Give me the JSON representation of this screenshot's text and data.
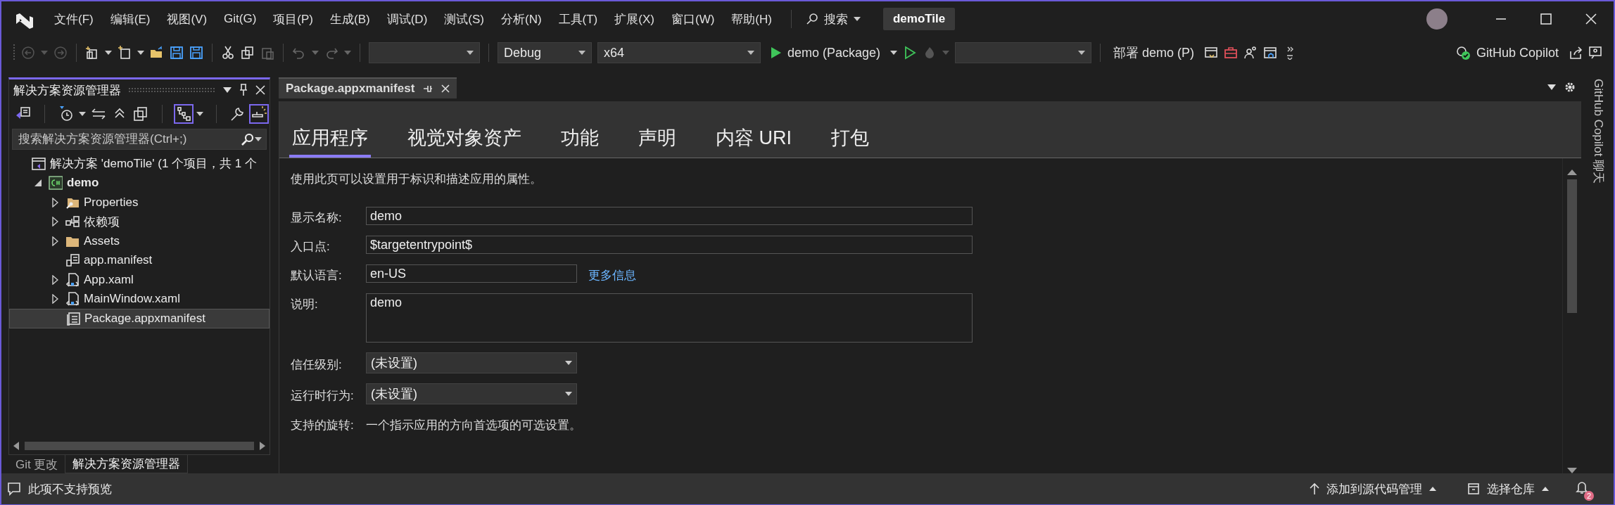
{
  "menu": [
    "文件(F)",
    "编辑(E)",
    "视图(V)",
    "Git(G)",
    "项目(P)",
    "生成(B)",
    "调试(D)",
    "测试(S)",
    "分析(N)",
    "工具(T)",
    "扩展(X)",
    "窗口(W)",
    "帮助(H)"
  ],
  "search": {
    "label": "搜索"
  },
  "project_title": "demoTile",
  "toolbar": {
    "configuration": "Debug",
    "platform": "x64",
    "run_target": "demo (Package)",
    "deploy": "部署 demo (P)",
    "copilot": "GitHub Copilot"
  },
  "solution_explorer": {
    "title": "解决方案资源管理器",
    "search": {
      "placeholder": "搜索解决方案资源管理器(Ctrl+;)"
    },
    "tree": [
      {
        "label": "解决方案 'demoTile' (1 个项目，共 1 个",
        "kind": "solution",
        "selected": false,
        "children": [
          {
            "label": "demo",
            "kind": "csharp-project",
            "expanded": true,
            "bold": true,
            "selected": false,
            "children": [
              {
                "label": "Properties",
                "kind": "properties-folder",
                "expanded": false,
                "selected": false
              },
              {
                "label": "依赖项",
                "kind": "dependencies",
                "expanded": false,
                "selected": false
              },
              {
                "label": "Assets",
                "kind": "folder",
                "expanded": false,
                "selected": false
              },
              {
                "label": "app.manifest",
                "kind": "manifest",
                "selected": false
              },
              {
                "label": "App.xaml",
                "kind": "xaml",
                "expanded": false,
                "selected": false
              },
              {
                "label": "MainWindow.xaml",
                "kind": "xaml",
                "expanded": false,
                "selected": false
              },
              {
                "label": "Package.appxmanifest",
                "kind": "appxmanifest",
                "selected": true
              }
            ]
          }
        ]
      }
    ],
    "bottom_tabs": [
      {
        "label": "Git 更改",
        "selected": false
      },
      {
        "label": "解决方案资源管理器",
        "selected": true
      }
    ]
  },
  "document_tab": {
    "title": "Package.appxmanifest"
  },
  "page_tabs": [
    {
      "label": "应用程序",
      "selected": true
    },
    {
      "label": "视觉对象资产",
      "selected": false
    },
    {
      "label": "功能",
      "selected": false
    },
    {
      "label": "声明",
      "selected": false
    },
    {
      "label": "内容 URI",
      "selected": false
    },
    {
      "label": "打包",
      "selected": false
    }
  ],
  "intro": "使用此页可以设置用于标识和描述应用的属性。",
  "fields": [
    {
      "kind": "text",
      "label": "显示名称:",
      "value": "demo"
    },
    {
      "kind": "text",
      "label": "入口点:",
      "value": "$targetentrypoint$"
    },
    {
      "kind": "short",
      "label": "默认语言:",
      "value": "en-US",
      "link": "更多信息"
    },
    {
      "kind": "textarea",
      "label": "说明:",
      "value": "demo"
    },
    {
      "kind": "dropdown",
      "label": "信任级别:",
      "value": "(未设置)"
    },
    {
      "kind": "dropdown",
      "label": "运行时行为:",
      "value": "(未设置)"
    },
    {
      "kind": "static",
      "label": "支持的旋转:",
      "value": "一个指示应用的方向首选项的可选设置。"
    }
  ],
  "side_panel": {
    "title": "GitHub Copilot 聊天"
  },
  "status_bar": {
    "message": "此项不支持预览",
    "source_control": "添加到源代码管理",
    "repository": "选择仓库",
    "notifications": "2"
  }
}
